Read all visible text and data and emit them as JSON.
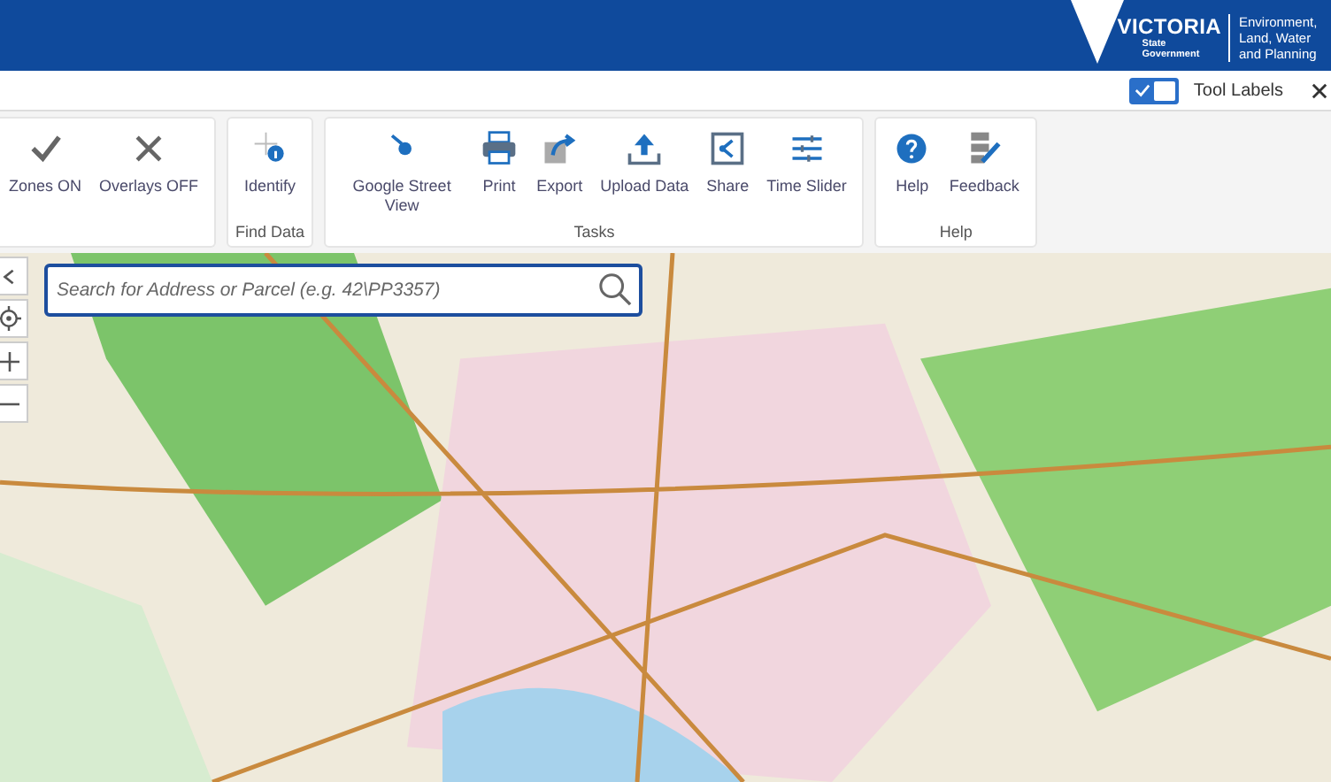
{
  "header": {
    "logo": {
      "wordmark": "VICTORIA",
      "sub": "State Government"
    },
    "department": "Environment, Land, Water and Planning"
  },
  "options_bar": {
    "tool_labels": {
      "label": "Tool Labels",
      "checked": true
    }
  },
  "toolbar": {
    "groups": [
      {
        "tools": [
          {
            "label": "Zones ON",
            "kind": "check"
          },
          {
            "label": "Overlays OFF",
            "kind": "cross"
          }
        ]
      },
      {
        "title": "Find Data",
        "tools": [
          {
            "label": "Identify",
            "kind": "identify"
          }
        ]
      },
      {
        "title": "Tasks",
        "tools": [
          {
            "label": "Google Street View",
            "kind": "pin"
          },
          {
            "label": "Print",
            "kind": "print"
          },
          {
            "label": "Export",
            "kind": "export"
          },
          {
            "label": "Upload Data",
            "kind": "upload"
          },
          {
            "label": "Share",
            "kind": "share"
          },
          {
            "label": "Time Slider",
            "kind": "slider"
          }
        ]
      },
      {
        "title": "Help",
        "tools": [
          {
            "label": "Help",
            "kind": "help"
          },
          {
            "label": "Feedback",
            "kind": "feedback"
          }
        ]
      }
    ]
  },
  "map": {
    "search": {
      "placeholder": "Search for Address or Parcel (e.g. 42\\PP3357)"
    }
  }
}
